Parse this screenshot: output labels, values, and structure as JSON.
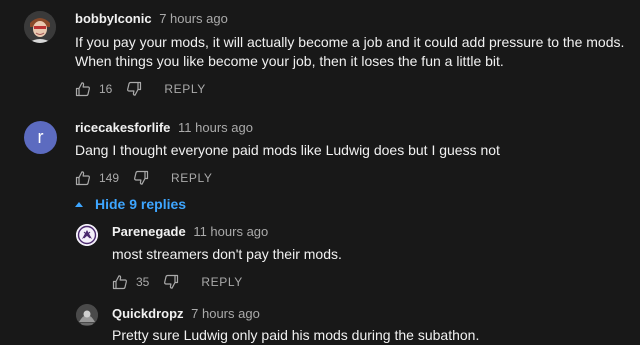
{
  "comments": [
    {
      "author": "bobbyIconic",
      "time": "7 hours ago",
      "lines": [
        "If you pay your mods, it will actually become a job and it could add pressure to the mods.",
        "When things you like become your job, then it loses the fun a little bit."
      ],
      "likes": "16",
      "reply_label": "REPLY"
    },
    {
      "author": "ricecakesforlife",
      "time": "11 hours ago",
      "avatar_letter": "r",
      "avatar_color": "#5c6bc0",
      "lines": [
        "Dang I thought everyone paid mods like Ludwig does but I guess not"
      ],
      "likes": "149",
      "reply_label": "REPLY"
    }
  ],
  "hide_replies_label": "Hide 9 replies",
  "replies": [
    {
      "author": "Parenegade",
      "time": "11 hours ago",
      "text": "most streamers don't pay their mods.",
      "likes": "35",
      "reply_label": "REPLY"
    },
    {
      "author": "Quickdropz",
      "time": "7 hours ago",
      "text": "Pretty sure Ludwig only paid his mods during the subathon."
    }
  ],
  "colors": {
    "background": "#181818",
    "link_blue": "#3ea6ff",
    "muted_text": "#aaaaaa"
  }
}
